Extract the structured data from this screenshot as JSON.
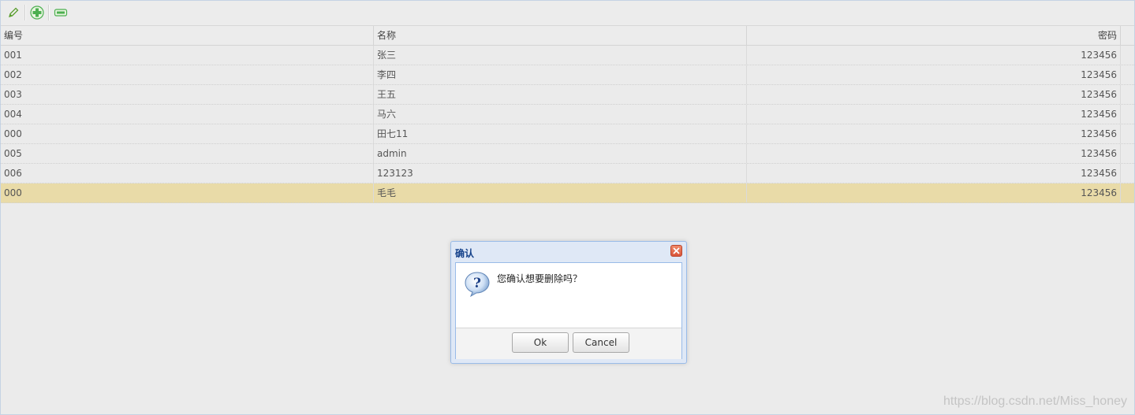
{
  "toolbar": {
    "buttons": [
      {
        "icon": "pencil-icon",
        "color": "#5a9e2f"
      },
      {
        "icon": "plus-circle-icon",
        "color": "#4caf50"
      },
      {
        "icon": "minus-icon",
        "color": "#4caf50"
      }
    ]
  },
  "grid": {
    "columns": [
      "编号",
      "名称",
      "密码"
    ],
    "rows": [
      [
        "001",
        "张三",
        "123456"
      ],
      [
        "002",
        "李四",
        "123456"
      ],
      [
        "003",
        "王五",
        "123456"
      ],
      [
        "004",
        "马六",
        "123456"
      ],
      [
        "000",
        "田七11",
        "123456"
      ],
      [
        "005",
        "admin",
        "123456"
      ],
      [
        "006",
        "123123",
        "123456"
      ],
      [
        "000",
        "毛毛",
        "123456"
      ]
    ],
    "selected_row": 7,
    "selected_color": "#e9dba8"
  },
  "dialog": {
    "title": "确认",
    "message": "您确认想要删除吗？",
    "icon": "question-icon",
    "ok_label": "Ok",
    "cancel_label": "Cancel"
  },
  "watermark": "https://blog.csdn.net/Miss_honey"
}
